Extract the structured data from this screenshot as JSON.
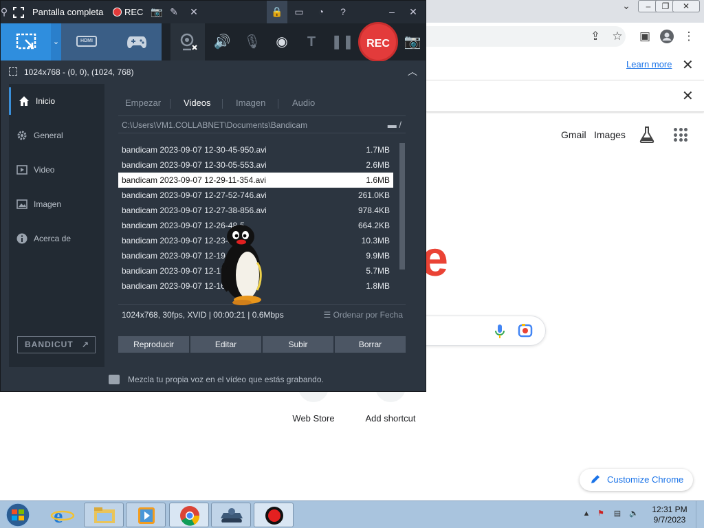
{
  "bandicam": {
    "title_mode": "Pantalla completa",
    "title_rec": "REC",
    "region_text": "1024x768 - (0, 0), (1024, 768)",
    "rec_button": "REC",
    "sidebar": [
      {
        "label": "Inicio",
        "icon": "home-icon"
      },
      {
        "label": "General",
        "icon": "gear-icon"
      },
      {
        "label": "Video",
        "icon": "video-icon"
      },
      {
        "label": "Imagen",
        "icon": "image-icon"
      },
      {
        "label": "Acerca de",
        "icon": "info-icon"
      }
    ],
    "bandicut_label": "BANDICUT",
    "tabs": [
      "Empezar",
      "Videos",
      "Imagen",
      "Audio"
    ],
    "path": "C:\\Users\\VM1.COLLABNET\\Documents\\Bandicam",
    "path_suffix": "/",
    "files": [
      {
        "name": "bandicam 2023-09-07 12-30-45-950.avi",
        "size": "1.7MB"
      },
      {
        "name": "bandicam 2023-09-07 12-30-05-553.avi",
        "size": "2.6MB"
      },
      {
        "name": "bandicam 2023-09-07 12-29-11-354.avi",
        "size": "1.6MB"
      },
      {
        "name": "bandicam 2023-09-07 12-27-52-746.avi",
        "size": "261.0KB"
      },
      {
        "name": "bandicam 2023-09-07 12-27-38-856.avi",
        "size": "978.4KB"
      },
      {
        "name": "bandicam 2023-09-07 12-26-48-5",
        "size": "664.2KB"
      },
      {
        "name": "bandicam 2023-09-07 12-23-3",
        "size": "10.3MB"
      },
      {
        "name": "bandicam 2023-09-07 12-19-",
        "size": "9.9MB"
      },
      {
        "name": "bandicam 2023-09-07 12-17-",
        "size": "5.7MB"
      },
      {
        "name": "bandicam 2023-09-07 12-16-",
        "size": "1.8MB"
      }
    ],
    "selected_file": 2,
    "file_info": "1024x768, 30fps, XVID | 00:00:21 | 0.6Mbps",
    "sort_label": "Ordenar por Fecha",
    "actions": [
      "Reproducir",
      "Editar",
      "Subir",
      "Borrar"
    ],
    "status_tip": "Mezcla tu propia voz en el vídeo que estás grabando."
  },
  "chrome": {
    "learn_more": "Learn more",
    "gmail": "Gmail",
    "images": "Images",
    "shortcuts": [
      "Web Store",
      "Add shortcut"
    ],
    "customize": "Customize Chrome"
  },
  "taskbar": {
    "time": "12:31 PM",
    "date": "9/7/2023"
  }
}
